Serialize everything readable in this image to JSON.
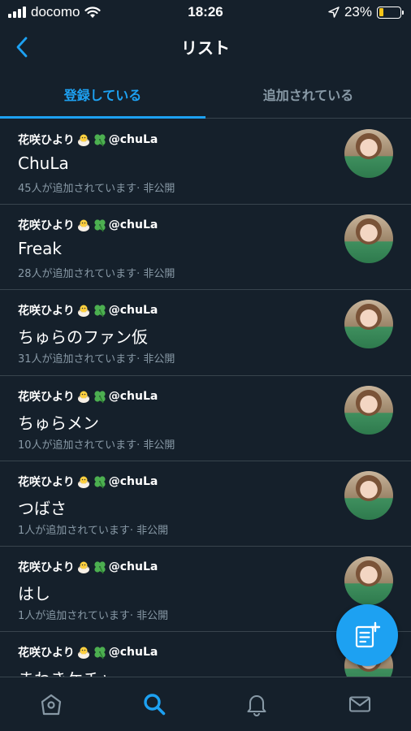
{
  "status_bar": {
    "carrier": "docomo",
    "time": "18:26",
    "battery_percent": "23%",
    "battery_level": 0.23
  },
  "nav": {
    "title": "リスト"
  },
  "tabs": [
    {
      "label": "登録している",
      "active": true
    },
    {
      "label": "追加されている",
      "active": false
    }
  ],
  "lists": [
    {
      "owner_name": "花咲ひより",
      "owner_handle": "@chuLa",
      "name": "ChuLa",
      "meta": "45人が追加されています· 非公開"
    },
    {
      "owner_name": "花咲ひより",
      "owner_handle": "@chuLa",
      "name": "Freak",
      "meta": "28人が追加されています· 非公開"
    },
    {
      "owner_name": "花咲ひより",
      "owner_handle": "@chuLa",
      "name": "ちゅらのファン仮",
      "meta": "31人が追加されています· 非公開"
    },
    {
      "owner_name": "花咲ひより",
      "owner_handle": "@chuLa",
      "name": "ちゅらメン",
      "meta": "10人が追加されています· 非公開"
    },
    {
      "owner_name": "花咲ひより",
      "owner_handle": "@chuLa",
      "name": "つばさ",
      "meta": "1人が追加されています· 非公開"
    },
    {
      "owner_name": "花咲ひより",
      "owner_handle": "@chuLa",
      "name": "はし",
      "meta": "1人が追加されています· 非公開"
    },
    {
      "owner_name": "花咲ひより",
      "owner_handle": "@chuLa",
      "name": "まわきケチャ",
      "meta": ""
    }
  ],
  "colors": {
    "background": "#15202b",
    "accent": "#1da1f2",
    "divider": "#38444d",
    "secondary_text": "#8899a6"
  },
  "icons": {
    "owner_emoji_1": "chick-icon",
    "owner_emoji_2": "four-leaf-clover-icon",
    "fab": "new-list-icon",
    "tab_bar": [
      "home-icon",
      "search-icon",
      "notifications-bell-icon",
      "messages-envelope-icon"
    ]
  }
}
